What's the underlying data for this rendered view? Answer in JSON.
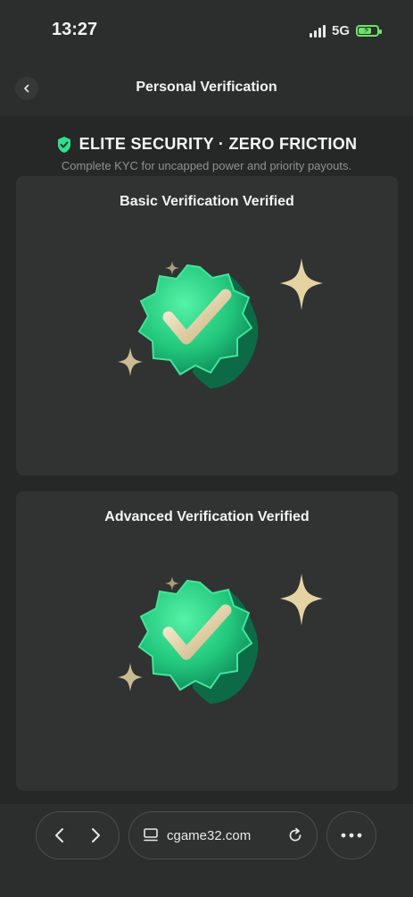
{
  "status_bar": {
    "time": "13:27",
    "network": "5G"
  },
  "header": {
    "title": "Personal Verification"
  },
  "hero": {
    "title": "ELITE SECURITY · ZERO FRICTION",
    "subtitle": "Complete KYC for uncapped power and priority payouts."
  },
  "cards": [
    {
      "title": "Basic Verification Verified"
    },
    {
      "title": "Advanced Verification Verified"
    }
  ],
  "browser": {
    "url": "cgame32.com"
  },
  "colors": {
    "accent": "#2fe08c",
    "badge_dark": "#0f8a5a",
    "sparkle": "#e6d3a3",
    "background": "#252827",
    "card": "#303332"
  }
}
